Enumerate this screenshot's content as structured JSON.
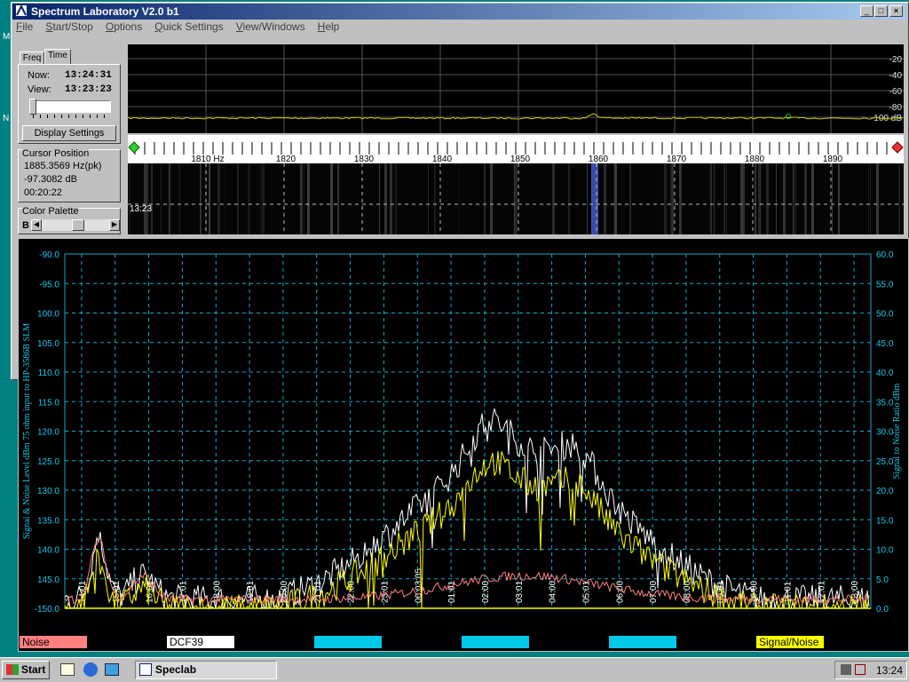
{
  "desktop": {
    "icon_letters": [
      "M",
      "N"
    ]
  },
  "window": {
    "title": "Spectrum Laboratory V2.0 b1",
    "menu": [
      "File",
      "Start/Stop",
      "Options",
      "Quick Settings",
      "View/Windows",
      "Help"
    ]
  },
  "side_panel": {
    "tabs": [
      "Freq",
      "Time"
    ],
    "now_label": "Now:",
    "now_value": "13:24:31",
    "view_label": "View:",
    "view_value": "13:23:23",
    "display_settings": "Display Settings",
    "cursor_title": "Cursor Position",
    "cursor_freq": "1885.3569 Hz(pk)",
    "cursor_db": "-97.3082 dB",
    "cursor_time": "00:20:22",
    "palette_title": "Color Palette",
    "palette_b": "B"
  },
  "spectrum": {
    "db_ticks": [
      "-20",
      "-40",
      "-60",
      "-80",
      "-100 dB"
    ],
    "freq_ticks": [
      "1810 Hz",
      "1820",
      "1830",
      "1840",
      "1850",
      "1860",
      "1870",
      "1880",
      "1890"
    ],
    "waterfall_time": "13:23"
  },
  "chart_data": {
    "type": "line",
    "ylabel": "Signal & Noise Level dBm 75 ohm input to HP-3586B SLM",
    "y2label": "Signal to Noise Ratio   dBm",
    "ylim": [
      -150,
      -90
    ],
    "y2lim": [
      0,
      60
    ],
    "y_ticks": [
      "-90.0",
      "-95.0",
      "100.0",
      "105.0",
      "110.0",
      "115.0",
      "120.0",
      "125.0",
      "130.0",
      "135.0",
      "140.0",
      "145.0",
      "-150.0"
    ],
    "y2_ticks": [
      "60.0",
      "55.0",
      "50.0",
      "45.0",
      "40.0",
      "35.0",
      "30.0",
      "25.0",
      "20.0",
      "15.0",
      "10.0",
      "5.0",
      "0.0"
    ],
    "x_ticks": [
      "14:01",
      "15:01",
      "16:01",
      "17:01",
      "18:00",
      "19:01",
      "20:00",
      "21:01",
      "22:00",
      "23:01",
      "00:03:05",
      "01:01",
      "02:00",
      "03:01",
      "04:00",
      "05:01",
      "06:00",
      "07:00",
      "08:00",
      "09:01",
      "10:00",
      "11:01",
      "12:01",
      "13:00"
    ],
    "series": [
      {
        "name": "Signal/Noise",
        "color": "#ffff00"
      },
      {
        "name": "Noise",
        "color": "#ff8080"
      },
      {
        "name": "DCF39",
        "color": "#ffffff"
      }
    ],
    "grid": true
  },
  "legend": [
    {
      "label": "Noise",
      "bg": "#ff8080",
      "fg": "#000000"
    },
    {
      "label": "DCF39",
      "bg": "#ffffff",
      "fg": "#000000"
    },
    {
      "label": "",
      "bg": "#00c8e8",
      "fg": "#000000"
    },
    {
      "label": "",
      "bg": "#00c8e8",
      "fg": "#000000"
    },
    {
      "label": "",
      "bg": "#00c8e8",
      "fg": "#000000"
    },
    {
      "label": "Signal/Noise",
      "bg": "#ffff00",
      "fg": "#000000"
    }
  ],
  "taskbar": {
    "start": "Start",
    "task": "Speclab",
    "clock": "13:24"
  }
}
